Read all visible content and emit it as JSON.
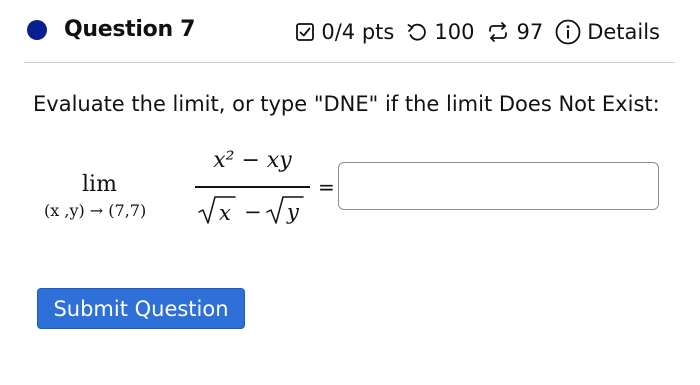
{
  "question": {
    "title": "Question 7",
    "points": "0/4 pts",
    "retries": "100",
    "attempts": "97",
    "details_label": "Details"
  },
  "prompt": "Evaluate the limit, or type \"DNE\" if the limit Does Not Exist:",
  "math": {
    "lim_word": "lim",
    "lim_sub": "(x ,y) → (7,7)",
    "numerator": "x² − xy",
    "denominator": "√x − √y",
    "equals": "="
  },
  "answer": {
    "value": ""
  },
  "submit_label": "Submit Question",
  "icons": [
    "question-status-dot-icon",
    "checkbox-icon",
    "undo-icon",
    "repeat-icon",
    "info-icon"
  ],
  "colors": {
    "status_dot": "#0a1f8f",
    "submit_bg": "#2f6fd8"
  }
}
